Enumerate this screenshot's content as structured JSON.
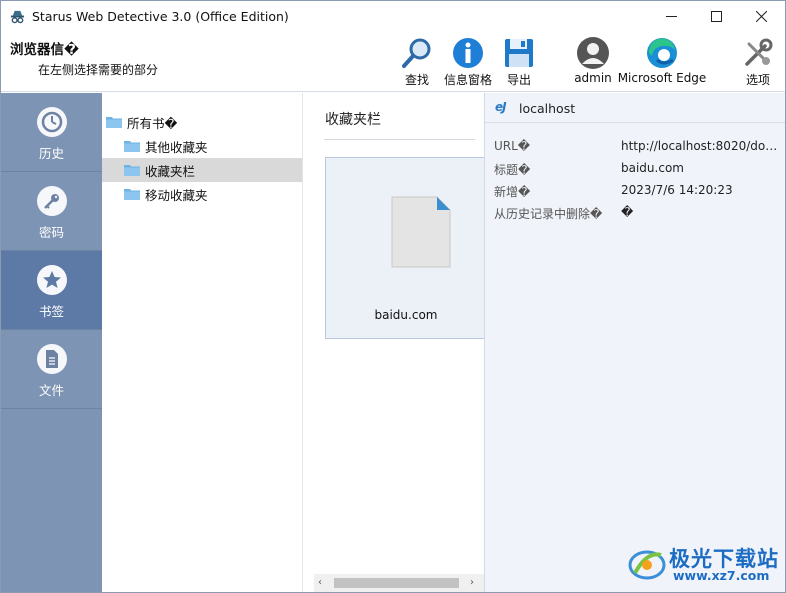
{
  "window": {
    "title": "Starus Web Detective 3.0 (Office Edition)"
  },
  "toolbar": {
    "heading": "浏览器信�",
    "subheading": "在左侧选择需要的部分",
    "buttons": [
      {
        "label": "查找",
        "icon": "magnifier-icon"
      },
      {
        "label": "信息窗格",
        "icon": "info-icon"
      },
      {
        "label": "导出",
        "icon": "floppy-disk-icon"
      },
      {
        "label": "admin",
        "icon": "user-avatar-icon"
      },
      {
        "label": "Microsoft Edge",
        "icon": "edge-browser-icon"
      },
      {
        "label": "选项",
        "icon": "tools-icon"
      }
    ]
  },
  "nav": {
    "items": [
      {
        "label": "历史",
        "icon": "clock-icon",
        "active": false
      },
      {
        "label": "密码",
        "icon": "key-icon",
        "active": false
      },
      {
        "label": "书签",
        "icon": "star-icon",
        "active": true
      },
      {
        "label": "文件",
        "icon": "document-icon",
        "active": false
      }
    ]
  },
  "tree": {
    "root": "所有书�",
    "children": [
      "其他收藏夹",
      "收藏夹栏",
      "移动收藏夹"
    ],
    "selected": "收藏夹栏"
  },
  "content": {
    "title": "收藏夹栏",
    "items": [
      {
        "label": "baidu.com",
        "icon": "file-icon"
      }
    ]
  },
  "details": {
    "host": "localhost",
    "rows": [
      {
        "key": "URL�",
        "value": "http://localhost:8020/doc/..."
      },
      {
        "key": "标题�",
        "value": "baidu.com"
      },
      {
        "key": "新增�",
        "value": "2023/7/6 14:20:23"
      },
      {
        "key": "从历史记录中删除�",
        "value": "�"
      }
    ]
  },
  "watermark": {
    "brand": "极光下载站",
    "url": "www.xz7.com"
  },
  "colors": {
    "nav_bg": "#7e94b4",
    "nav_active": "#5d7aa6",
    "details_bg": "#f0f4fa",
    "accent_blue": "#1d6cc4"
  }
}
